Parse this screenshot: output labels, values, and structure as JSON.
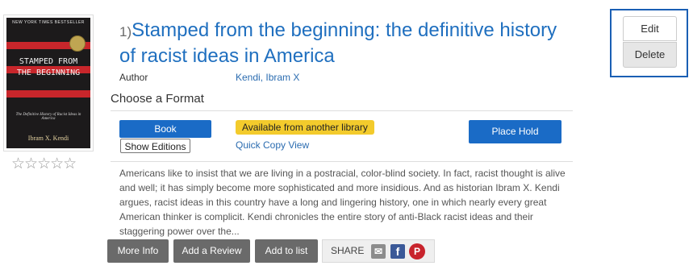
{
  "record": {
    "number": "1)",
    "title": "Stamped from the beginning: the definitive history of racist ideas in America",
    "author_label": "Author",
    "author": "Kendi, Ibram X",
    "rating_stars": "☆☆☆☆☆",
    "rating": 0
  },
  "cover": {
    "top_line": "NEW YORK TIMES BESTSELLER",
    "title_text": "STAMPED FROM THE BEGINNING",
    "subtitle_text": "The Definitive History of Racist Ideas in America",
    "author_text": "Ibram X. Kendi"
  },
  "format": {
    "heading": "Choose a Format",
    "format_button": "Book",
    "show_editions": "Show Editions",
    "availability": "Available from another library",
    "quick_copy": "Quick Copy View",
    "place_hold": "Place Hold"
  },
  "description": "Americans like to insist that we are living in a postracial, color-blind society. In fact, racist thought is alive and well; it has simply become more sophisticated and more insidious. And as historian Ibram X. Kendi argues, racist ideas in this country have a long and lingering history, one in which nearly every great American thinker is complicit. Kendi chronicles the entire story of anti-Black racist ideas and their staggering power over the...",
  "actions": {
    "more_info": "More Info",
    "add_review": "Add a Review",
    "add_to_list": "Add to list",
    "share_label": "SHARE"
  },
  "admin": {
    "edit": "Edit",
    "delete": "Delete"
  },
  "icons": {
    "email": "email-icon",
    "facebook": "facebook-icon",
    "pinterest": "pinterest-icon"
  },
  "colors": {
    "primary": "#1a6bc6",
    "link": "#1f6fbf",
    "availability_bg": "#f3cb2c",
    "action_bg": "#6a6a6a"
  }
}
